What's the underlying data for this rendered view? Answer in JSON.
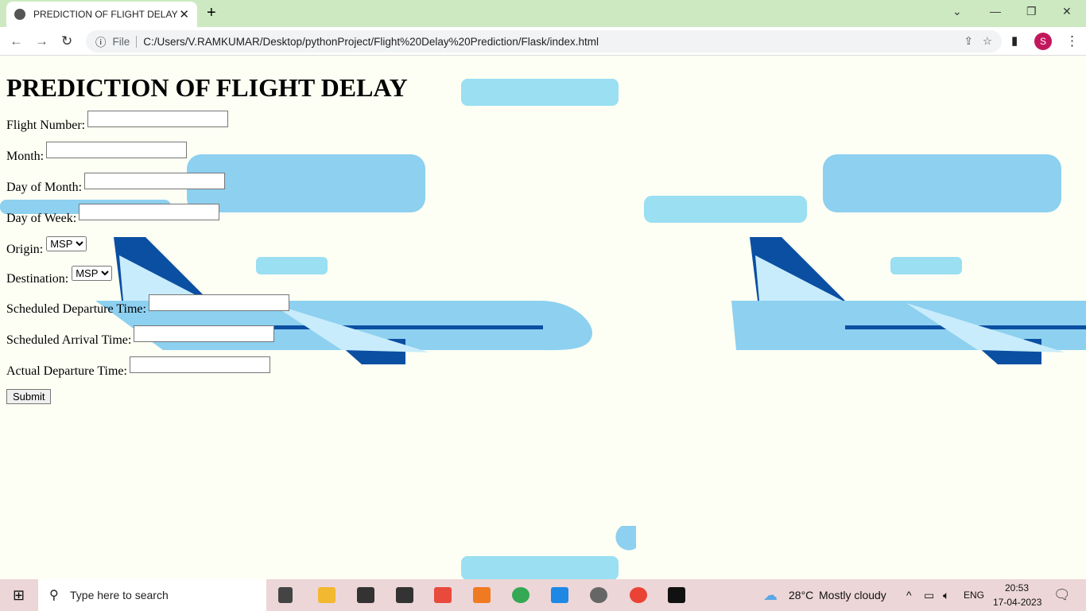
{
  "browser": {
    "tab_title": "PREDICTION OF FLIGHT DELAY",
    "url_scheme": "File",
    "url": "C:/Users/V.RAMKUMAR/Desktop/pythonProject/Flight%20Delay%20Prediction/Flask/index.html",
    "profile_initial": "S"
  },
  "page": {
    "title": "PREDICTION OF FLIGHT DELAY",
    "fields": {
      "flight_number": "Flight Number:",
      "month": "Month:",
      "day_of_month": "Day of Month:",
      "day_of_week": "Day of Week:",
      "origin": "Origin:",
      "destination": "Destination:",
      "sched_dep": "Scheduled Departure Time:",
      "sched_arr": "Scheduled Arrival Time:",
      "actual_dep": "Actual Departure Time:"
    },
    "origin_value": "MSP",
    "destination_value": "MSP",
    "submit": "Submit"
  },
  "taskbar": {
    "search_placeholder": "Type here to search",
    "temperature": "28°C",
    "weather": "Mostly cloudy",
    "language": "ENG",
    "time": "20:53",
    "date": "17-04-2023"
  }
}
